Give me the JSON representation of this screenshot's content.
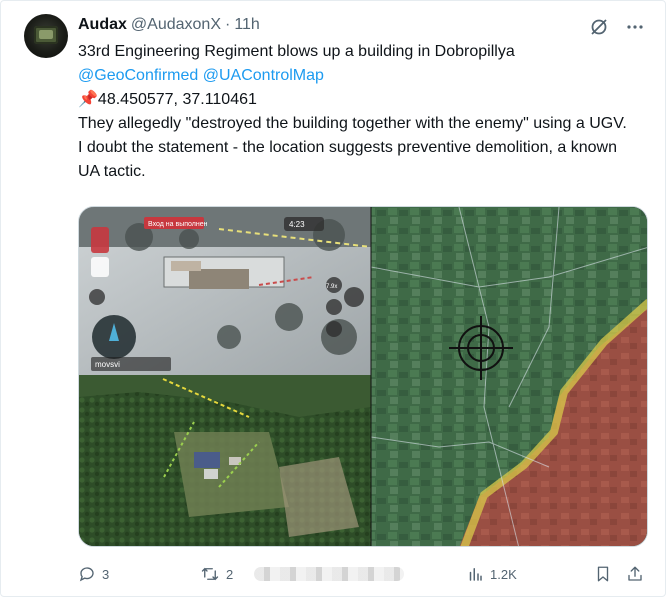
{
  "author": {
    "name": "Audax",
    "handle": "@AudaxonX",
    "separator": "·",
    "time": "11h"
  },
  "tweet": {
    "line1": "33rd Engineering Regiment blows up a building in Dobropillya",
    "mention1": "@GeoConfirmed",
    "mention2": "@UAControlMap",
    "pin": "📌",
    "coordinates": "48.450577, 37.110461",
    "line3": "They allegedly \"destroyed the building together with the enemy\" using a UGV.",
    "line4": "I doubt the statement - the location suggests preventive demolition, a known UA tactic."
  },
  "media": {
    "drone_overlay_label": "Вход на выполнен",
    "drone_time": "4:23",
    "drone_brand": "movsvi",
    "zoom_indicator": "7.9x"
  },
  "metrics": {
    "replies": "3",
    "reposts": "2",
    "likes": "",
    "views": "1.2K"
  },
  "icons": {
    "grok": "grok-icon",
    "more": "more-icon",
    "reply": "reply-icon",
    "repost": "repost-icon",
    "views": "views-icon",
    "bookmark": "bookmark-icon",
    "share": "share-icon"
  },
  "colors": {
    "link": "#1d9bf0",
    "muted": "#536471",
    "text": "#0f1419"
  }
}
